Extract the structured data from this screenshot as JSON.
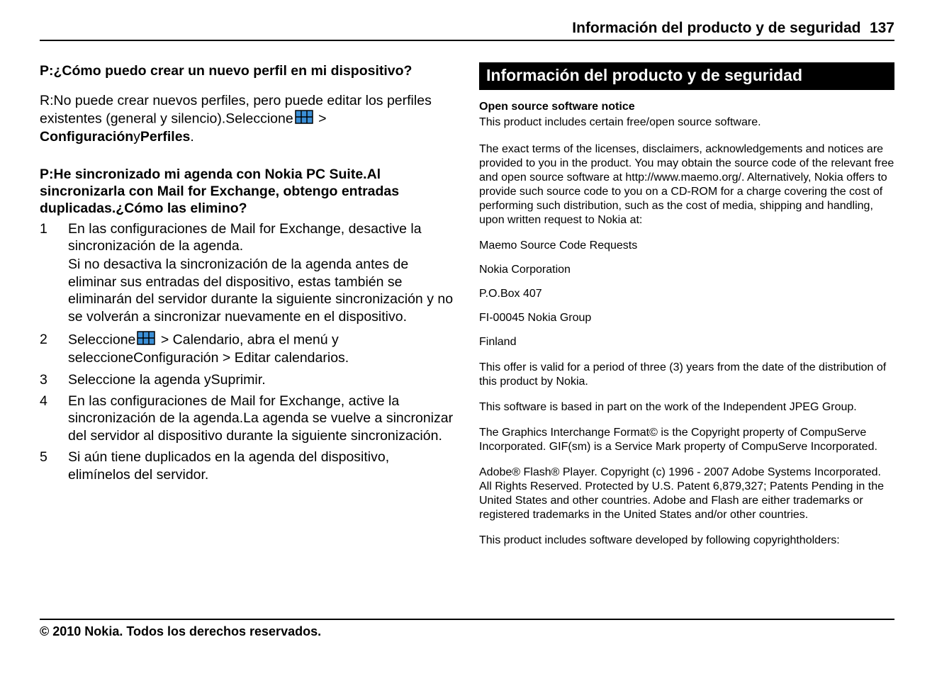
{
  "header": {
    "title": "Información del producto y de seguridad",
    "page_number": "137"
  },
  "left": {
    "q1": {
      "prefix": "P:",
      "question": "¿Cómo puedo crear un nuevo perfil en mi dispositivo?",
      "a_prefix": "R:",
      "a_line1": "No puede crear nuevos perfiles, pero puede editar los perfiles existentes (general y silencio).Seleccione",
      "gt": " > ",
      "cfg": "Configuración",
      "y": "y",
      "perfiles": "Perfiles",
      "dot": "."
    },
    "q2": {
      "prefix": "P:",
      "question": "He sincronizado mi agenda con Nokia PC Suite.Al sincronizarla con Mail for Exchange, obtengo entradas duplicadas.¿Cómo las elimino?",
      "steps": [
        {
          "num": "1",
          "p1": "En las configuraciones de Mail for Exchange, desactive la sincronización de la agenda.",
          "p2": "Si no desactiva la sincronización de la agenda antes de eliminar sus entradas del dispositivo, estas también se eliminarán del servidor durante la siguiente sincronización y no se volverán a sincronizar nuevamente en el dispositivo."
        },
        {
          "num": "2",
          "pre": "Seleccione",
          "gt1": " > ",
          "cal": "Calendario",
          "mid": ", abra el menú y seleccione",
          "cfg": "Configuración",
          "gt2": " > ",
          "edit": "Editar calendarios",
          "dot": "."
        },
        {
          "num": "3",
          "pre": "Seleccione la agenda y",
          "supr": "Suprimir",
          "dot": "."
        },
        {
          "num": "4",
          "text": "En las configuraciones de Mail for Exchange, active la sincronización de la agenda.La agenda se vuelve a sincronizar del servidor al dispositivo durante la siguiente sincronización."
        },
        {
          "num": "5",
          "text": "Si aún tiene duplicados en la agenda del dispositivo, elimínelos del servidor."
        }
      ]
    }
  },
  "right": {
    "section_title": "Información del producto y de seguridad",
    "notice_heading": "Open source software notice",
    "p1": "This product includes certain free/open source software.",
    "p2": "The exact terms of the licenses, disclaimers, acknowledgements and notices are provided to you in the product. You may obtain the source code of the relevant free and open source software at http://www.maemo.org/. Alternatively, Nokia offers to provide such source code to you on a CD-ROM for a charge covering the cost of performing such distribution, such as the cost of media, shipping and handling, upon written request to Nokia at:",
    "addr": [
      "Maemo Source Code Requests",
      "Nokia Corporation",
      "P.O.Box 407",
      "FI-00045 Nokia Group",
      "Finland"
    ],
    "p3": "This offer is valid for a period of three (3) years from the date of the distribution of this product by Nokia.",
    "p4": "This software is based in part on the work of the Independent JPEG Group.",
    "p5": "The Graphics Interchange Format© is the Copyright property of CompuServe Incorporated. GIF(sm) is a Service Mark property of CompuServe Incorporated.",
    "p6": "Adobe® Flash® Player. Copyright (c) 1996 - 2007 Adobe Systems Incorporated. All Rights Reserved. Protected by U.S. Patent 6,879,327; Patents Pending in the United States and other countries. Adobe and Flash are either trademarks or registered trademarks in the United States and/or other countries.",
    "p7": "This product includes software developed by following copyrightholders:"
  },
  "footer": "© 2010 Nokia. Todos los derechos reservados.",
  "icons": {
    "grid_fill": "#3b8fd6",
    "grid_stroke": "#000"
  }
}
